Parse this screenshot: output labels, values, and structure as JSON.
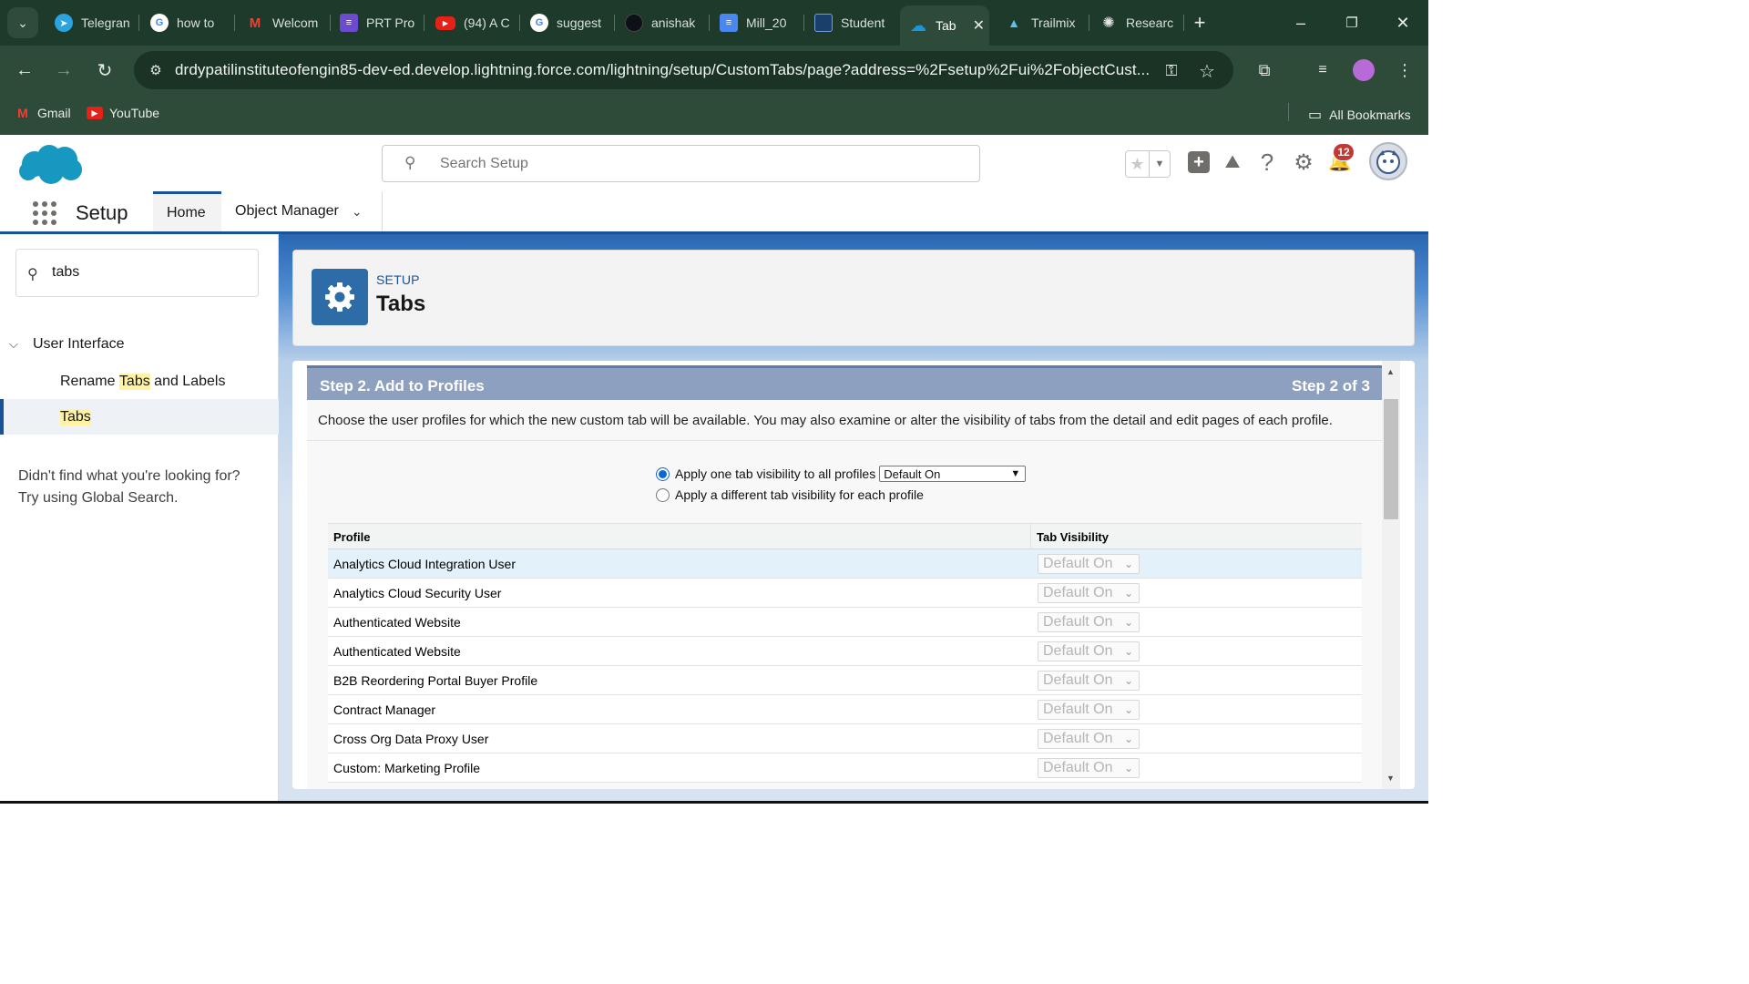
{
  "browser": {
    "tabs": [
      {
        "title": "Telegran",
        "fav_color": "#2aa3df",
        "fav_glyph": "➤"
      },
      {
        "title": "how to",
        "fav_color": "#ffffff",
        "fav_glyph": "G"
      },
      {
        "title": "Welcom",
        "fav_color": "#ffffff",
        "fav_glyph": "M"
      },
      {
        "title": "PRT Pro",
        "fav_color": "#6c4bd1",
        "fav_glyph": "≡"
      },
      {
        "title": "(94) A C",
        "fav_color": "#e62117",
        "fav_glyph": "▶"
      },
      {
        "title": "suggest",
        "fav_color": "#ffffff",
        "fav_glyph": "G"
      },
      {
        "title": "anishak",
        "fav_color": "#1b1f23",
        "fav_glyph": "●"
      },
      {
        "title": "Mill_20",
        "fav_color": "#4a87f0",
        "fav_glyph": "≡"
      },
      {
        "title": "Student",
        "fav_color": "#1a3f6b",
        "fav_glyph": "▢"
      },
      {
        "title": "Tab",
        "fav_color": "#1c96db",
        "fav_glyph": "☁",
        "active": true
      },
      {
        "title": "Trailmix",
        "fav_color": "#0b5cab",
        "fav_glyph": "▲"
      },
      {
        "title": "Researc",
        "fav_color": "#202020",
        "fav_glyph": "✺"
      }
    ],
    "url": "drdypatilinstituteofengin85-dev-ed.develop.lightning.force.com/lightning/setup/CustomTabs/page?address=%2Fsetup%2Fui%2FobjectCust...",
    "bookmarks": [
      {
        "label": "Gmail"
      },
      {
        "label": "YouTube"
      }
    ],
    "all_bookmarks_label": "All Bookmarks"
  },
  "sf_header": {
    "search_placeholder": "Search Setup",
    "notification_count": "12"
  },
  "nav": {
    "app_name": "Setup",
    "tabs": [
      {
        "label": "Home"
      },
      {
        "label": "Object Manager"
      }
    ]
  },
  "sidebar": {
    "quickfind_value": "tabs",
    "section_label": "User Interface",
    "item_rename_prefix": "Rename ",
    "item_rename_highlight": "Tabs",
    "item_rename_suffix": " and Labels",
    "item_tabs": "Tabs",
    "help_line1": "Didn't find what you're looking for?",
    "help_line2": "Try using Global Search."
  },
  "page_header": {
    "eyebrow": "SETUP",
    "title": "Tabs"
  },
  "step": {
    "title": "Step 2. Add to Profiles",
    "count": "Step 2 of 3",
    "description": "Choose the user profiles for which the new custom tab will be available. You may also examine or alter the visibility of tabs from the detail and edit pages of each profile.",
    "option_all": "Apply one tab visibility to all profiles",
    "option_all_value": "Default On",
    "option_each": "Apply a different tab visibility for each profile"
  },
  "profile_table": {
    "col_profile": "Profile",
    "col_visibility": "Tab Visibility",
    "rows": [
      {
        "profile": "Analytics Cloud Integration User",
        "visibility": "Default On"
      },
      {
        "profile": "Analytics Cloud Security User",
        "visibility": "Default On"
      },
      {
        "profile": "Authenticated Website",
        "visibility": "Default On"
      },
      {
        "profile": "Authenticated Website",
        "visibility": "Default On"
      },
      {
        "profile": "B2B Reordering Portal Buyer Profile",
        "visibility": "Default On"
      },
      {
        "profile": "Contract Manager",
        "visibility": "Default On"
      },
      {
        "profile": "Cross Org Data Proxy User",
        "visibility": "Default On"
      },
      {
        "profile": "Custom: Marketing Profile",
        "visibility": "Default On"
      }
    ]
  },
  "colors": {
    "browser_frame": "#1e3a2b",
    "salesforce_blue": "#1b5297",
    "step_bar": "#8ea0bf"
  }
}
